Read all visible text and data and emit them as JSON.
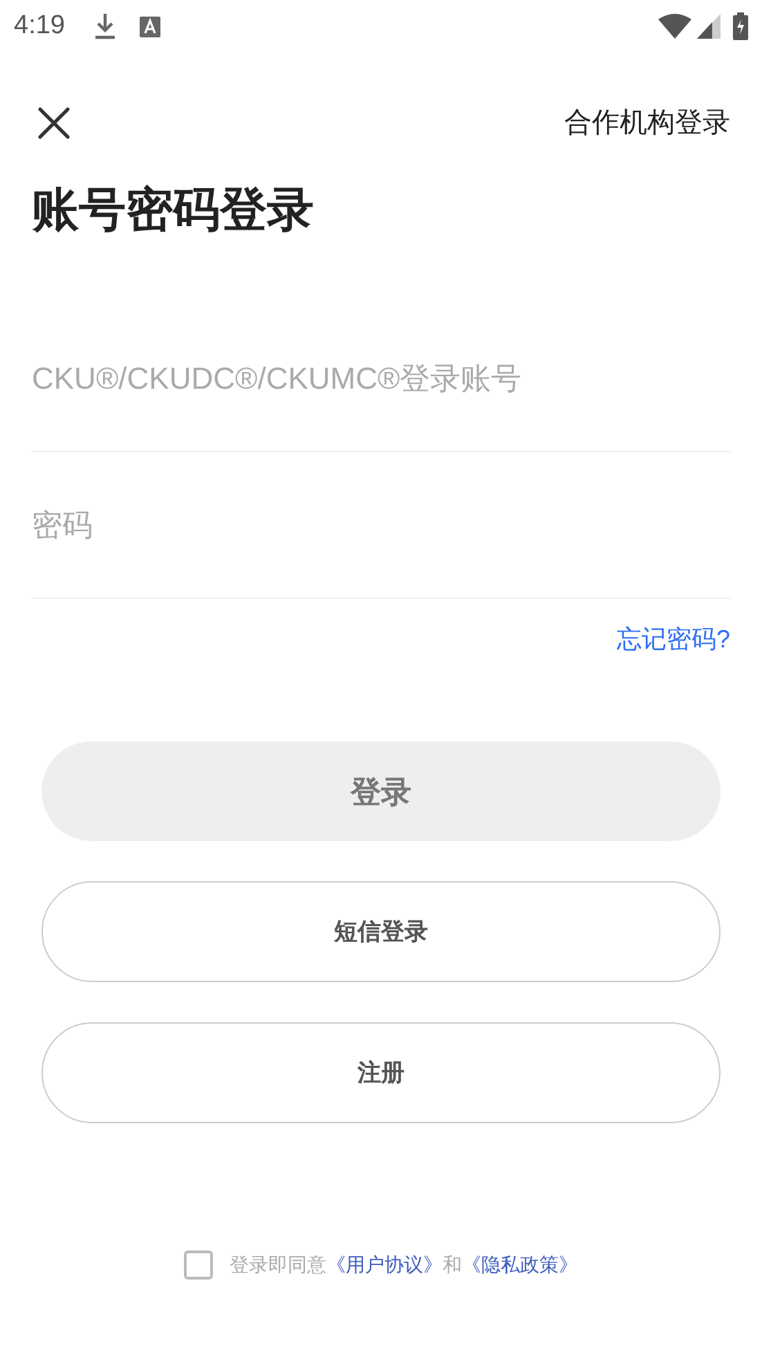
{
  "status_bar": {
    "time": "4:19"
  },
  "header": {
    "partner_login": "合作机构登录"
  },
  "title": "账号密码登录",
  "fields": [
    {
      "placeholder": "CKU®/CKUDC®/CKUMC®登录账号"
    },
    {
      "placeholder": "密码"
    }
  ],
  "forgot_password": "忘记密码?",
  "buttons": [
    {
      "kind": "primary",
      "label": "登录",
      "disabled": true
    },
    {
      "kind": "outline",
      "label": "短信登录",
      "disabled": false
    },
    {
      "kind": "outline",
      "label": "注册",
      "disabled": false
    }
  ],
  "agreement": {
    "checked": false,
    "text": "登录即同意",
    "user_agreement": "《用户协议》",
    "and": "和",
    "privacy_policy": "《隐私政策》"
  }
}
